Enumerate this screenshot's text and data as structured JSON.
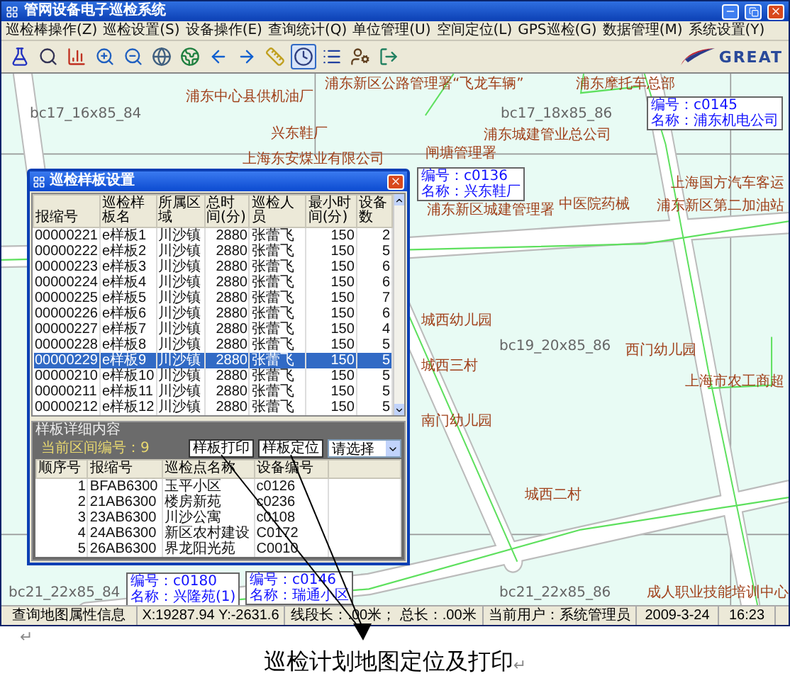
{
  "window": {
    "title": "管网设备电子巡检系统"
  },
  "menu": [
    "巡检棒操作(Z)",
    "巡检设置(S)",
    "设备操作(E)",
    "查询统计(Q)",
    "单位管理(U)",
    "空间定位(L)",
    "GPS巡检(G)",
    "数据管理(M)",
    "系统设置(Y)"
  ],
  "toolbar": [
    {
      "kind": "flask",
      "selected": false
    },
    {
      "kind": "search",
      "selected": false
    },
    {
      "kind": "chart",
      "selected": false
    },
    {
      "kind": "zoomin",
      "selected": false
    },
    {
      "kind": "zoomout",
      "selected": false
    },
    {
      "kind": "globe",
      "selected": false
    },
    {
      "kind": "earth",
      "selected": false
    },
    {
      "kind": "back",
      "selected": false
    },
    {
      "kind": "forward",
      "selected": false
    },
    {
      "kind": "ruler",
      "selected": false
    },
    {
      "kind": "clock",
      "selected": true
    },
    {
      "kind": "list",
      "selected": false
    },
    {
      "kind": "user",
      "selected": false
    },
    {
      "kind": "exit",
      "selected": false
    }
  ],
  "logo": {
    "text": "GREAT"
  },
  "map": {
    "labels": [
      {
        "kind": "grid",
        "text": "bc17_16x85_84"
      },
      {
        "kind": "place",
        "text": "浦东中心县供机油厂"
      },
      {
        "kind": "place",
        "text": "浦东新区公路管理署“飞龙车辆”"
      },
      {
        "kind": "place",
        "text": "浦东摩托车总部"
      },
      {
        "kind": "grid",
        "text": "bc17_18x85_86"
      },
      {
        "kind": "place",
        "text": "兴东鞋厂"
      },
      {
        "kind": "place",
        "text": "浦东城建管业总公司"
      },
      {
        "kind": "place",
        "text": "闸塘管理署"
      },
      {
        "kind": "place",
        "text": "上海东安煤业有限公司"
      },
      {
        "kind": "place",
        "text": "浦东新区城建管理署"
      },
      {
        "kind": "place",
        "text": "中医院药械"
      },
      {
        "kind": "place",
        "text": "上海国方汽车客运"
      },
      {
        "kind": "place",
        "text": "浦东新区第二加油站"
      },
      {
        "kind": "place",
        "text": "城西幼儿园"
      },
      {
        "kind": "grid",
        "text": "bc19_20x85_86"
      },
      {
        "kind": "place",
        "text": "西门幼儿园"
      },
      {
        "kind": "place",
        "text": "城西三村"
      },
      {
        "kind": "place",
        "text": "南门幼儿园"
      },
      {
        "kind": "place",
        "text": "城西二村"
      },
      {
        "kind": "place",
        "text": "上海市农工商超"
      },
      {
        "kind": "grid",
        "text": "bc21_22x85_84"
      },
      {
        "kind": "grid",
        "text": "bc21_22x85_86"
      },
      {
        "kind": "place",
        "text": "成人职业技能培训中心"
      }
    ],
    "callouts": [
      {
        "lines": [
          "编号：c0136",
          "名称：兴东鞋厂"
        ]
      },
      {
        "lines": [
          "编号：c0145",
          "名称：浦东机电公司"
        ]
      },
      {
        "lines": [
          "编号：c0180",
          "名称：兴隆苑(1)"
        ]
      },
      {
        "lines": [
          "编号：c0146",
          "名称：瑞通小区"
        ]
      }
    ]
  },
  "dialog": {
    "title": "巡检样板设置",
    "columns": [
      "报缩号",
      "巡检样板名",
      "所属区域",
      "总时间(分)",
      "巡检人员",
      "最小时间(分)",
      "设备数"
    ],
    "rows": [
      {
        "cells": [
          "00000221",
          "e样板1",
          "川沙镇",
          "2880",
          "张蕾飞",
          "150",
          "2"
        ],
        "selected": false
      },
      {
        "cells": [
          "00000222",
          "e样板2",
          "川沙镇",
          "2880",
          "张蕾飞",
          "150",
          "5"
        ],
        "selected": false
      },
      {
        "cells": [
          "00000223",
          "e样板3",
          "川沙镇",
          "2880",
          "张蕾飞",
          "150",
          "6"
        ],
        "selected": false
      },
      {
        "cells": [
          "00000224",
          "e样板4",
          "川沙镇",
          "2880",
          "张蕾飞",
          "150",
          "6"
        ],
        "selected": false
      },
      {
        "cells": [
          "00000225",
          "e样板5",
          "川沙镇",
          "2880",
          "张蕾飞",
          "150",
          "7"
        ],
        "selected": false
      },
      {
        "cells": [
          "00000226",
          "e样板6",
          "川沙镇",
          "2880",
          "张蕾飞",
          "150",
          "6"
        ],
        "selected": false
      },
      {
        "cells": [
          "00000227",
          "e样板7",
          "川沙镇",
          "2880",
          "张蕾飞",
          "150",
          "4"
        ],
        "selected": false
      },
      {
        "cells": [
          "00000228",
          "e样板8",
          "川沙镇",
          "2880",
          "张蕾飞",
          "150",
          "5"
        ],
        "selected": false
      },
      {
        "cells": [
          "00000229",
          "e样板9",
          "川沙镇",
          "2880",
          "张蕾飞",
          "150",
          "5"
        ],
        "selected": true
      },
      {
        "cells": [
          "00000210",
          "e样板10",
          "川沙镇",
          "2880",
          "张蕾飞",
          "150",
          "5"
        ],
        "selected": false
      },
      {
        "cells": [
          "00000211",
          "e样板11",
          "川沙镇",
          "2880",
          "张蕾飞",
          "150",
          "5"
        ],
        "selected": false
      },
      {
        "cells": [
          "00000212",
          "e样板12",
          "川沙镇",
          "2880",
          "张蕾飞",
          "150",
          "5"
        ],
        "selected": false
      }
    ],
    "detail": {
      "group_title": "样板详细内容",
      "current": "当前区间编号：9",
      "buttons": [
        "样板打印",
        "样板定位"
      ],
      "select": {
        "value": "请选择"
      },
      "columns": [
        "顺序号",
        "报缩号",
        "巡检点名称",
        "设备编号"
      ],
      "rows": [
        [
          "1",
          "BFAB6300",
          "玉平小区",
          "c0126"
        ],
        [
          "2",
          "21AB6300",
          "楼房新苑",
          "c0236"
        ],
        [
          "3",
          "23AB6300",
          "川沙公寓",
          "c0108"
        ],
        [
          "4",
          "24AB6300",
          "新区农村建设",
          "C0172"
        ],
        [
          "5",
          "26AB6300",
          "界龙阳光苑",
          "C0010"
        ]
      ]
    }
  },
  "status_bar": [
    "查询地图属性信息",
    "X:19287.94 Y:-2631.6",
    "线段长：.00米；  总长：.00米",
    "当前用户：系统管理员",
    "2009-3-24",
    "16:23"
  ],
  "caption": {
    "text": "巡检计划地图定位及打印",
    "mark": "↵",
    "blank_mark": "↵"
  }
}
